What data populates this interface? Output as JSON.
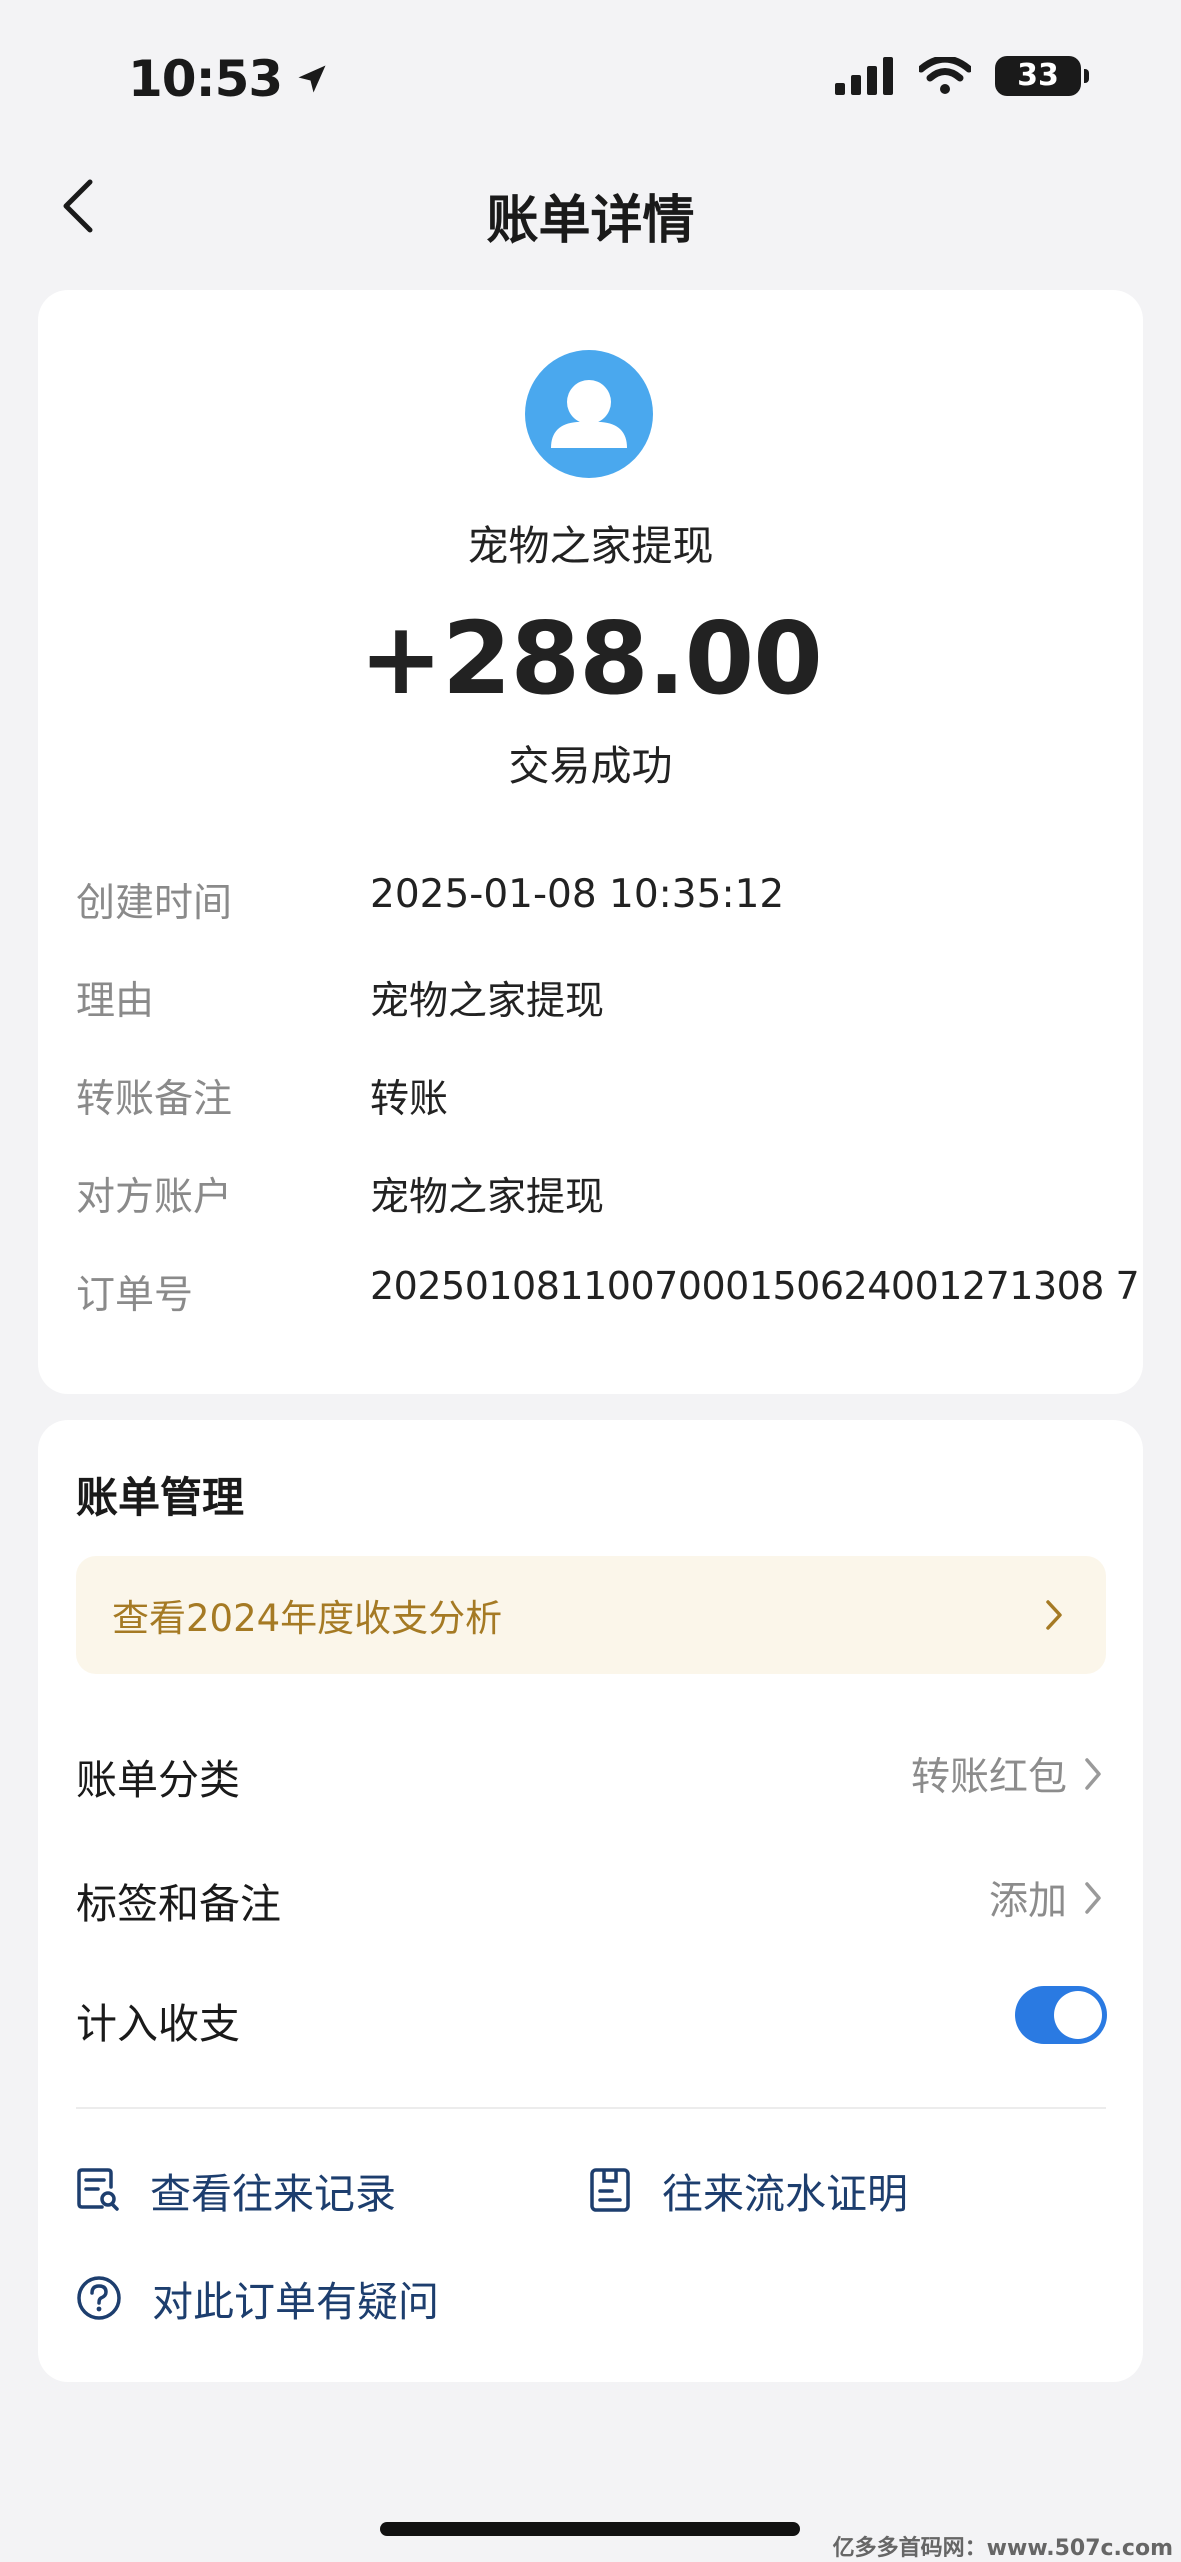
{
  "status_bar": {
    "time": "10:53",
    "battery": "33"
  },
  "nav": {
    "title": "账单详情"
  },
  "transaction": {
    "payee": "宠物之家提现",
    "amount": "+288.00",
    "status": "交易成功"
  },
  "details": [
    {
      "label": "创建时间",
      "value": "2025-01-08 10:35:12"
    },
    {
      "label": "理由",
      "value": "宠物之家提现"
    },
    {
      "label": "转账备注",
      "value": "转账"
    },
    {
      "label": "对方账户",
      "value": "宠物之家提现"
    },
    {
      "label": "订单号",
      "value": "2025010811007000150624001271308 7"
    }
  ],
  "management": {
    "title": "账单管理",
    "annual_banner": "查看2024年度收支分析",
    "category_label": "账单分类",
    "category_value": "转账红包",
    "tags_label": "标签和备注",
    "tags_value": "添加",
    "include_label": "计入收支",
    "include_enabled": true
  },
  "actions": {
    "records": "查看往来记录",
    "proof": "往来流水证明",
    "question": "对此订单有疑问"
  },
  "watermark": "亿多多首码网：www.507c.com",
  "colors": {
    "accent_blue": "#2a7ae2",
    "avatar_blue": "#4aa8ee",
    "banner_text": "#a57a24",
    "action_text": "#1d3e6e"
  }
}
